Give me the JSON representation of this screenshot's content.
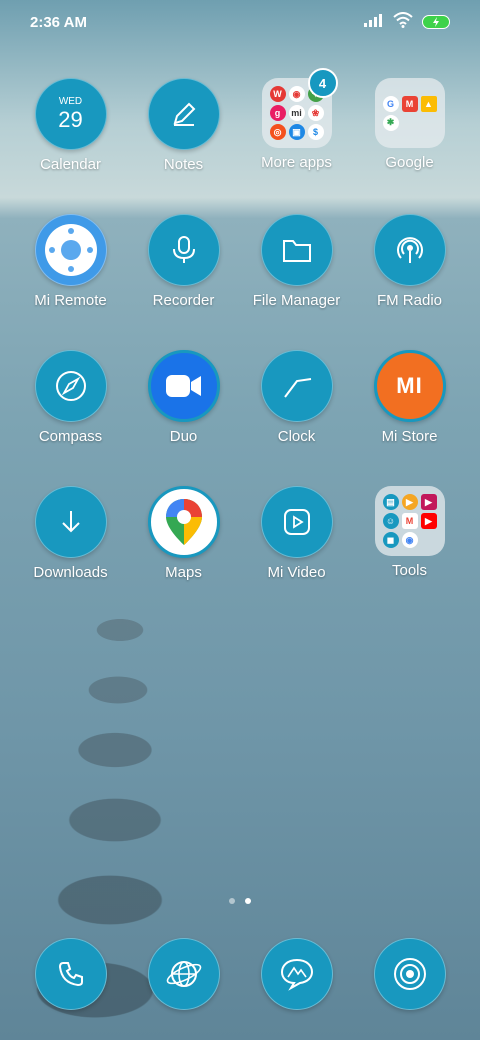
{
  "status": {
    "time": "2:36 AM"
  },
  "apps": [
    {
      "label": "Calendar",
      "day": "WED",
      "date": "29"
    },
    {
      "label": "Notes"
    },
    {
      "label": "More apps",
      "badge": "4"
    },
    {
      "label": "Google"
    },
    {
      "label": "Mi Remote"
    },
    {
      "label": "Recorder"
    },
    {
      "label": "File Manager"
    },
    {
      "label": "FM Radio"
    },
    {
      "label": "Compass"
    },
    {
      "label": "Duo"
    },
    {
      "label": "Clock"
    },
    {
      "label": "Mi Store",
      "logo": "MI"
    },
    {
      "label": "Downloads"
    },
    {
      "label": "Maps"
    },
    {
      "label": "Mi Video"
    },
    {
      "label": "Tools"
    }
  ],
  "dock": [
    {
      "icon": "phone-icon"
    },
    {
      "icon": "browser-icon"
    },
    {
      "icon": "messages-icon"
    },
    {
      "icon": "camera-icon"
    }
  ],
  "colors": {
    "icon_bg": "#1898bf",
    "mi_orange": "#f26f21",
    "battery_green": "#3ed24a"
  }
}
